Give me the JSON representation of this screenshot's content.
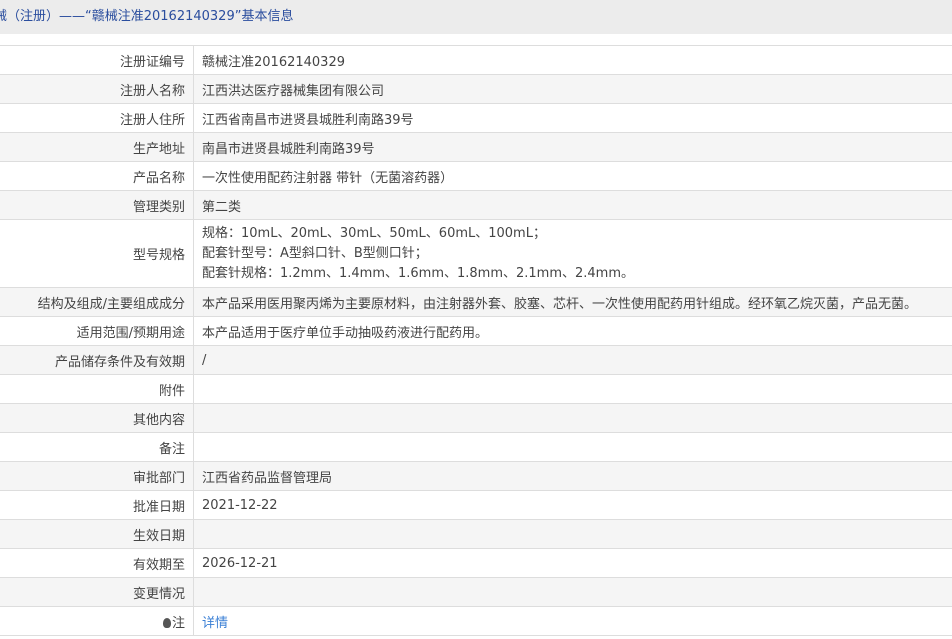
{
  "title": "械（注册）——“赣械注准20162140329”基本信息",
  "rows": [
    {
      "label": "注册证编号",
      "value": "赣械注准20162140329"
    },
    {
      "label": "注册人名称",
      "value": "江西洪达医疗器械集团有限公司"
    },
    {
      "label": "注册人住所",
      "value": "江西省南昌市进贤县城胜利南路39号"
    },
    {
      "label": "生产地址",
      "value": "南昌市进贤县城胜利南路39号"
    },
    {
      "label": "产品名称",
      "value": "一次性使用配药注射器 带针（无菌溶药器）"
    },
    {
      "label": "管理类别",
      "value": "第二类"
    },
    {
      "label": "型号规格",
      "lines": [
        "规格：10mL、20mL、30mL、50mL、60mL、100mL；",
        "配套针型号：A型斜口针、B型侧口针；",
        "配套针规格：1.2mm、1.4mm、1.6mm、1.8mm、2.1mm、2.4mm。"
      ]
    },
    {
      "label": "结构及组成/主要组成成分",
      "value": "本产品采用医用聚丙烯为主要原材料，由注射器外套、胶塞、芯杆、一次性使用配药用针组成。经环氧乙烷灭菌，产品无菌。"
    },
    {
      "label": "适用范围/预期用途",
      "value": "本产品适用于医疗单位手动抽吸药液进行配药用。"
    },
    {
      "label": "产品储存条件及有效期",
      "value": "/"
    },
    {
      "label": "附件",
      "value": ""
    },
    {
      "label": "其他内容",
      "value": ""
    },
    {
      "label": "备注",
      "value": ""
    },
    {
      "label": "审批部门",
      "value": "江西省药品监督管理局"
    },
    {
      "label": "批准日期",
      "value": "2021-12-22"
    },
    {
      "label": "生效日期",
      "value": ""
    },
    {
      "label": "有效期至",
      "value": "2026-12-21"
    },
    {
      "label": "变更情况",
      "value": ""
    },
    {
      "label": "注",
      "value": "详情"
    }
  ]
}
